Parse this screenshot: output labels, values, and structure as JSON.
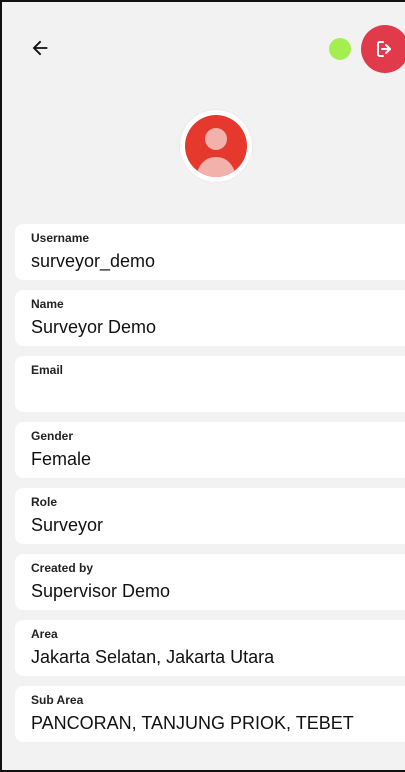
{
  "header": {
    "back_icon": "arrow-left-icon",
    "status_color": "#a5ee4f",
    "logout_icon": "logout-icon",
    "logout_color": "#e13a4b"
  },
  "profile": {
    "avatar_icon": "user-avatar-icon",
    "avatar_color": "#e5392e"
  },
  "fields": [
    {
      "label": "Username",
      "value": "surveyor_demo"
    },
    {
      "label": "Name",
      "value": "Surveyor Demo"
    },
    {
      "label": "Email",
      "value": ""
    },
    {
      "label": "Gender",
      "value": "Female"
    },
    {
      "label": "Role",
      "value": "Surveyor"
    },
    {
      "label": "Created by",
      "value": "Supervisor Demo"
    },
    {
      "label": "Area",
      "value": "Jakarta Selatan, Jakarta Utara"
    },
    {
      "label": "Sub Area",
      "value": "PANCORAN, TANJUNG PRIOK, TEBET"
    }
  ]
}
